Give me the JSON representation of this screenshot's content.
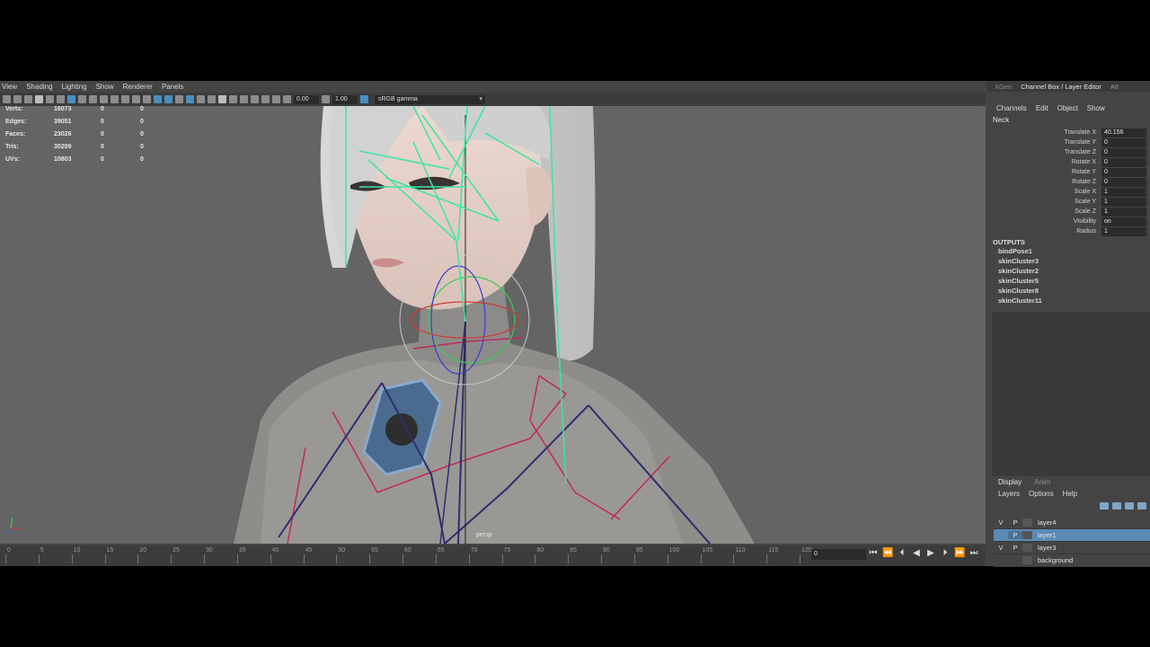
{
  "menu": {
    "items": [
      "View",
      "Shading",
      "Lighting",
      "Show",
      "Renderer",
      "Panels"
    ]
  },
  "toolbar": {
    "field_a": "0.00",
    "field_b": "1.00",
    "color_management": "sRGB gamma"
  },
  "hud": {
    "rows": [
      {
        "label": "Verts:",
        "value": "16073",
        "c1": "0",
        "c2": "0"
      },
      {
        "label": "Edges:",
        "value": "39051",
        "c1": "0",
        "c2": "0"
      },
      {
        "label": "Faces:",
        "value": "23026",
        "c1": "0",
        "c2": "0"
      },
      {
        "label": "Tris:",
        "value": "30299",
        "c1": "0",
        "c2": "0"
      },
      {
        "label": "UVs:",
        "value": "10803",
        "c1": "0",
        "c2": "0"
      }
    ]
  },
  "viewport": {
    "camera": "persp"
  },
  "timeline": {
    "ticks": [
      "0",
      "5",
      "10",
      "15",
      "20",
      "25",
      "30",
      "35",
      "40",
      "45",
      "50",
      "55",
      "60",
      "65",
      "70",
      "75",
      "80",
      "85",
      "90",
      "95",
      "100",
      "105",
      "110",
      "115",
      "120"
    ],
    "current_frame": "0",
    "range_start": "0"
  },
  "right_panel": {
    "tabs": [
      "XGen",
      "Channel Box / Layer Editor",
      "Att"
    ],
    "channel_menu": [
      "Channels",
      "Edit",
      "Object",
      "Show"
    ],
    "object": "Neck",
    "attributes": [
      {
        "name": "Translate X",
        "value": "40.156"
      },
      {
        "name": "Translate Y",
        "value": "0"
      },
      {
        "name": "Translate Z",
        "value": "0"
      },
      {
        "name": "Rotate X",
        "value": "0"
      },
      {
        "name": "Rotate Y",
        "value": "0"
      },
      {
        "name": "Rotate Z",
        "value": "0"
      },
      {
        "name": "Scale X",
        "value": "1"
      },
      {
        "name": "Scale Y",
        "value": "1"
      },
      {
        "name": "Scale Z",
        "value": "1"
      },
      {
        "name": "Visibility",
        "value": "on"
      },
      {
        "name": "Radius",
        "value": "1"
      }
    ],
    "outputs_header": "OUTPUTS",
    "outputs": [
      "bindPose1",
      "skinCluster3",
      "skinCluster2",
      "skinCluster5",
      "skinCluster8",
      "skinCluster11"
    ],
    "layer_tabs": [
      "Display",
      "Anim"
    ],
    "layer_menu": [
      "Layers",
      "Options",
      "Help"
    ],
    "layers": [
      {
        "v": "V",
        "p": "P",
        "name": "layer4",
        "selected": false
      },
      {
        "v": "",
        "p": "P",
        "name": "layer1",
        "selected": true
      },
      {
        "v": "V",
        "p": "P",
        "name": "layer3",
        "selected": false
      },
      {
        "v": "",
        "p": "",
        "name": "background",
        "selected": false
      }
    ]
  },
  "colors": {
    "viewport_bg": "#646464",
    "panel_bg": "#444444",
    "selection": "#5a8bb5",
    "joint": "#39e6a3"
  }
}
